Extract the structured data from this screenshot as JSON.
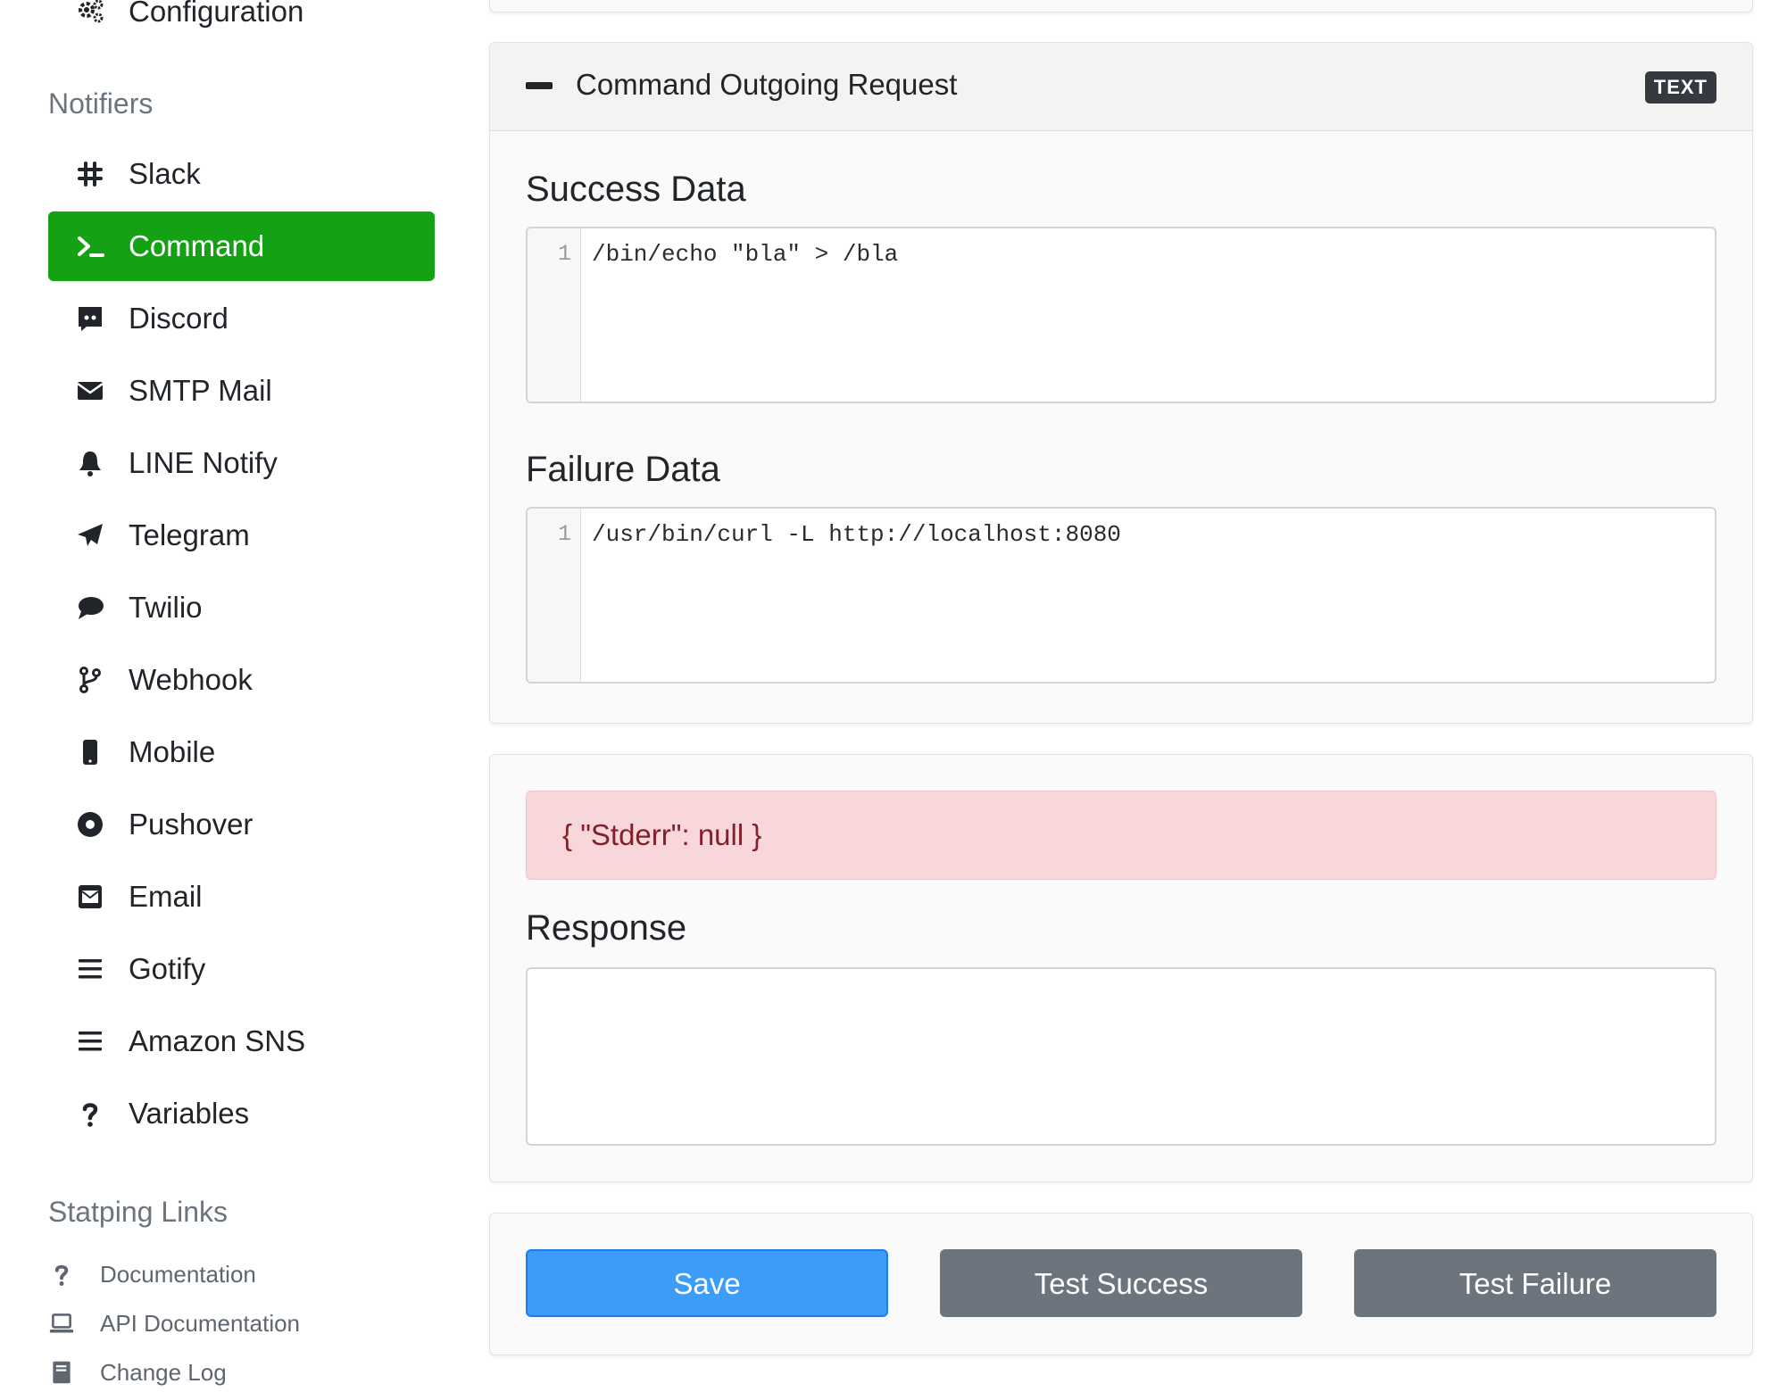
{
  "sidebar": {
    "top_item": {
      "label": "Configuration",
      "icon": "cogs-icon"
    },
    "notifiers_heading": "Notifiers",
    "items": [
      {
        "label": "Slack",
        "icon": "slack-icon",
        "active": false
      },
      {
        "label": "Command",
        "icon": "terminal-icon",
        "active": true
      },
      {
        "label": "Discord",
        "icon": "discord-icon",
        "active": false
      },
      {
        "label": "SMTP Mail",
        "icon": "envelope-icon",
        "active": false
      },
      {
        "label": "LINE Notify",
        "icon": "bell-icon",
        "active": false
      },
      {
        "label": "Telegram",
        "icon": "paper-plane-icon",
        "active": false
      },
      {
        "label": "Twilio",
        "icon": "comment-icon",
        "active": false
      },
      {
        "label": "Webhook",
        "icon": "code-branch-icon",
        "active": false
      },
      {
        "label": "Mobile",
        "icon": "mobile-icon",
        "active": false
      },
      {
        "label": "Pushover",
        "icon": "dot-circle-icon",
        "active": false
      },
      {
        "label": "Email",
        "icon": "envelope-square-icon",
        "active": false
      },
      {
        "label": "Gotify",
        "icon": "bars-icon",
        "active": false
      },
      {
        "label": "Amazon SNS",
        "icon": "bars-icon",
        "active": false
      },
      {
        "label": "Variables",
        "icon": "question-icon",
        "active": false
      }
    ],
    "links_heading": "Statping Links",
    "links": [
      {
        "label": "Documentation",
        "icon": "question-icon"
      },
      {
        "label": "API Documentation",
        "icon": "laptop-icon"
      },
      {
        "label": "Change Log",
        "icon": "book-icon"
      }
    ]
  },
  "request_card": {
    "title": "Command Outgoing Request",
    "badge": "TEXT",
    "success_label": "Success Data",
    "success_line": "1",
    "success_code": "/bin/echo \"bla\" > /bla",
    "failure_label": "Failure Data",
    "failure_line": "1",
    "failure_code": "/usr/bin/curl -L http://localhost:8080"
  },
  "response_card": {
    "alert_text": "{ \"Stderr\": null }",
    "response_label": "Response",
    "response_value": ""
  },
  "actions": {
    "save_label": "Save",
    "test_success_label": "Test Success",
    "test_failure_label": "Test Failure"
  },
  "colors": {
    "active_item": "#15a114",
    "primary_button": "#3d9cf8",
    "secondary_button": "#6c757d",
    "alert_background": "#f8d7da",
    "alert_text": "#842029"
  }
}
